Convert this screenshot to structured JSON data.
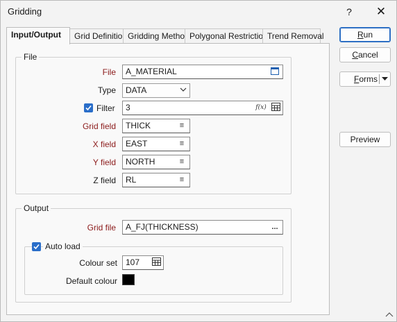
{
  "window": {
    "title": "Gridding",
    "help_label": "?",
    "close_label": "✕"
  },
  "tabs": [
    {
      "label": "Input/Output",
      "active": true
    },
    {
      "label": "Grid Definition"
    },
    {
      "label": "Gridding Method"
    },
    {
      "label": "Polygonal Restriction"
    },
    {
      "label": "Trend Removal"
    }
  ],
  "file_group": {
    "title": "File",
    "file": {
      "label": "File",
      "value": "A_MATERIAL"
    },
    "type": {
      "label": "Type",
      "value": "DATA"
    },
    "filter": {
      "label": "Filter",
      "checked": true,
      "value": "3",
      "fx_label": "f(x)"
    },
    "grid_field": {
      "label": "Grid field",
      "value": "THICK"
    },
    "x_field": {
      "label": "X field",
      "value": "EAST"
    },
    "y_field": {
      "label": "Y field",
      "value": "NORTH"
    },
    "z_field": {
      "label": "Z field",
      "value": "RL"
    }
  },
  "output_group": {
    "title": "Output",
    "grid_file": {
      "label": "Grid file",
      "value": "A_FJ(THICKNESS)",
      "browse_label": "..."
    },
    "auto_load": {
      "label": "Auto load",
      "checked": true
    },
    "colour_set": {
      "label": "Colour set",
      "value": "107"
    },
    "default_colour": {
      "label": "Default colour",
      "color": "#000000"
    }
  },
  "buttons": {
    "run": {
      "first": "R",
      "rest": "un"
    },
    "cancel": {
      "first": "C",
      "rest": "ancel"
    },
    "forms": {
      "first": "F",
      "rest": "orms"
    },
    "preview": "Preview"
  },
  "colors": {
    "accent": "#2a6ec9",
    "required_label": "#8b1a1a"
  }
}
